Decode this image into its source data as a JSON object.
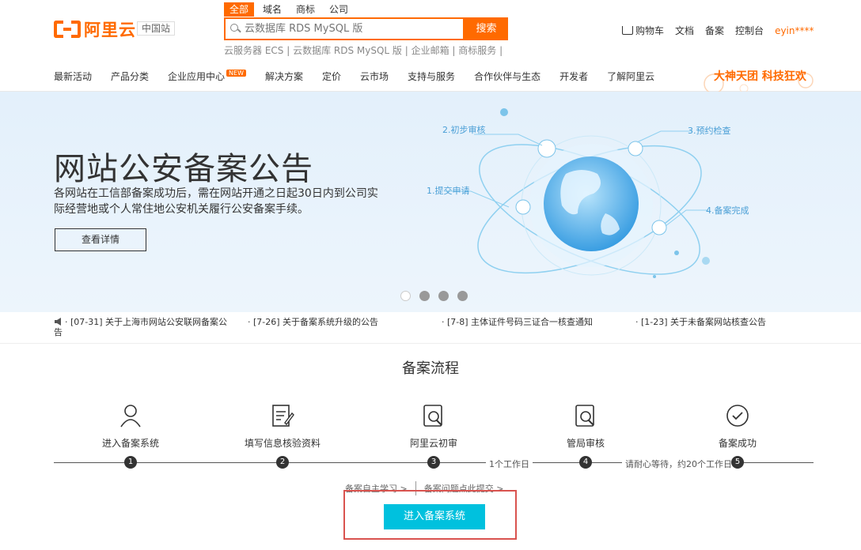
{
  "header": {
    "brand": "阿里云",
    "site": "中国站",
    "search_tabs": [
      "全部",
      "域名",
      "商标",
      "公司"
    ],
    "search_placeholder": "云数据库 RDS MySQL 版",
    "search_button": "搜索",
    "hot_links": "云服务器 ECS | 云数据库 RDS MySQL 版 | 企业邮箱 | 商标服务 |",
    "top_links": {
      "cart": "购物车",
      "docs": "文档",
      "filing": "备案",
      "console": "控制台",
      "user": "eyin****"
    },
    "main_nav": [
      "最新活动",
      "产品分类",
      "企业应用中心",
      "解决方案",
      "定价",
      "云市场",
      "支持与服务",
      "合作伙伴与生态",
      "开发者",
      "了解阿里云"
    ],
    "new_badge": "NEW",
    "promo": "大神天团 科技狂欢"
  },
  "banner": {
    "title": "网站公安备案公告",
    "subtitle": "各网站在工信部备案成功后，需在网站开通之日起30日内到公司实际经营地或个人常住地公安机关履行公安备案手续。",
    "button": "查看详情",
    "steps": [
      "1.提交申请",
      "2.初步审核",
      "3.预约检查",
      "4.备案完成"
    ],
    "active_slide": 1,
    "slide_count": 4
  },
  "notices": [
    "[07-31] 关于上海市网站公安联网备案公告",
    "[7-26] 关于备案系统升级的公告",
    "[7-8] 主体证件号码三证合一核查通知",
    "[1-23] 关于未备案网站核查公告"
  ],
  "flow": {
    "title": "备案流程",
    "steps": [
      {
        "label": "进入备案系统",
        "num": "1",
        "icon": "user-icon"
      },
      {
        "label": "填写信息核验资料",
        "num": "2",
        "icon": "form-edit-icon"
      },
      {
        "label": "阿里云初审",
        "num": "3",
        "icon": "search-review-icon"
      },
      {
        "label": "管局审核",
        "num": "4",
        "icon": "search-review-icon"
      },
      {
        "label": "备案成功",
        "num": "5",
        "icon": "check-circle-icon"
      }
    ],
    "note_3_4": "1个工作日",
    "note_4_5": "请耐心等待，约20个工作日",
    "link_learn": "备案自主学习 >",
    "link_faq": "备案问题点此提交 >",
    "enter_button": "进入备案系统"
  },
  "colors": {
    "brand": "#ff6a00",
    "cta": "#00c1de",
    "highlight": "#d9534f"
  }
}
